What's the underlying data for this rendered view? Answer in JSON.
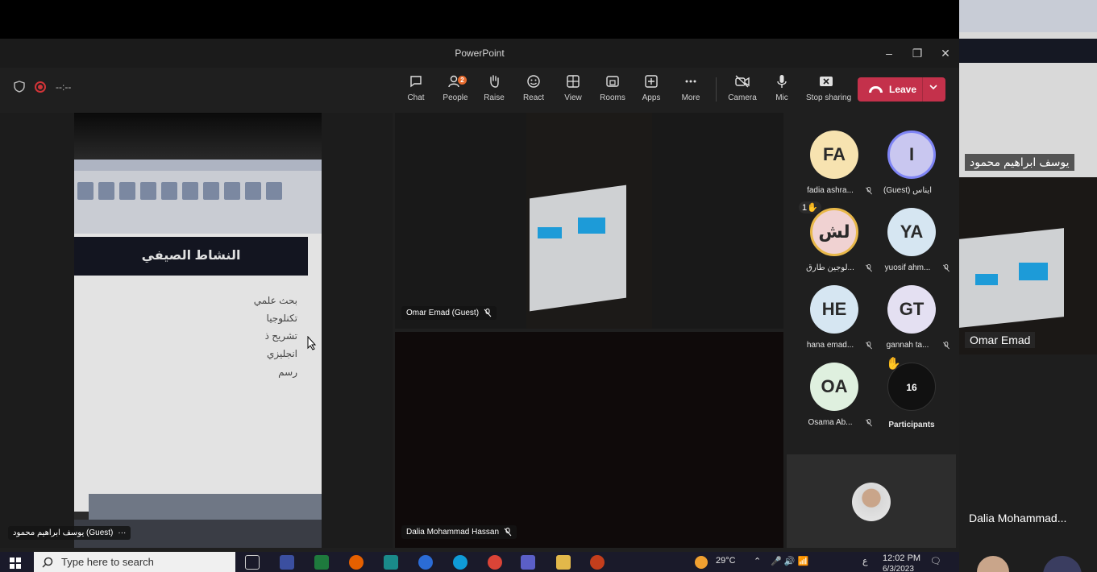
{
  "window": {
    "title": "PowerPoint",
    "controls": {
      "minimize": "–",
      "restore": "❐",
      "close": "✕"
    }
  },
  "toolbar": {
    "timer": "--:--",
    "buttons": [
      {
        "label": "Chat",
        "icon": "chat-icon"
      },
      {
        "label": "People",
        "icon": "people-icon",
        "badge": "2"
      },
      {
        "label": "Raise",
        "icon": "hand-icon"
      },
      {
        "label": "React",
        "icon": "smiley-icon"
      },
      {
        "label": "View",
        "icon": "grid-icon"
      },
      {
        "label": "Rooms",
        "icon": "rooms-icon"
      },
      {
        "label": "Apps",
        "icon": "plus-icon"
      },
      {
        "label": "More",
        "icon": "dots-icon"
      },
      {
        "label": "Camera",
        "icon": "camera-off-icon"
      },
      {
        "label": "Mic",
        "icon": "mic-icon"
      },
      {
        "label": "Stop sharing",
        "icon": "stop-share-icon"
      }
    ],
    "leave_label": "Leave",
    "accent": "#c4314b"
  },
  "tiles": {
    "main_share": {
      "name": "يوسف ابراهيم محمود (Guest)",
      "more": "···",
      "slide_title": "النشاط الصيفي",
      "bullets": [
        "بحث علمي",
        "تكنلوجيا",
        "تشريح ذ",
        "انجليزي",
        "رسم"
      ]
    },
    "omar": {
      "name": "Omar Emad (Guest)"
    },
    "dalia": {
      "name": "Dalia Mohammad Hassan"
    }
  },
  "participants": [
    {
      "initials": "FA",
      "name": "fadia ashra...",
      "color": "#f7e3b0"
    },
    {
      "initials": "I",
      "name": "(Guest) ايناس",
      "color": "#c9c7f0"
    },
    {
      "initials": "لش",
      "name": "لوجين طارق...",
      "color": "#f0d2d2",
      "hand_count": "1"
    },
    {
      "initials": "YA",
      "name": "yuosif ahm...",
      "color": "#d6e6f2"
    },
    {
      "initials": "HE",
      "name": "hana emad...",
      "color": "#d6e6f2"
    },
    {
      "initials": "GT",
      "name": "gannah ta...",
      "color": "#e4e0f2"
    },
    {
      "initials": "OA",
      "name": "Osama Ab...",
      "color": "#dff0df"
    }
  ],
  "participants_more": {
    "count": "16",
    "label": "Participants"
  },
  "side_strip": {
    "names": [
      "يوسف ابراهيم محمود",
      "Omar Emad",
      "Dalia Mohammad..."
    ]
  },
  "taskbar": {
    "search_placeholder": "Type here to search",
    "weather": "29°C",
    "time": "12:02 PM",
    "date": "6/3/2023",
    "lang": "ع"
  }
}
